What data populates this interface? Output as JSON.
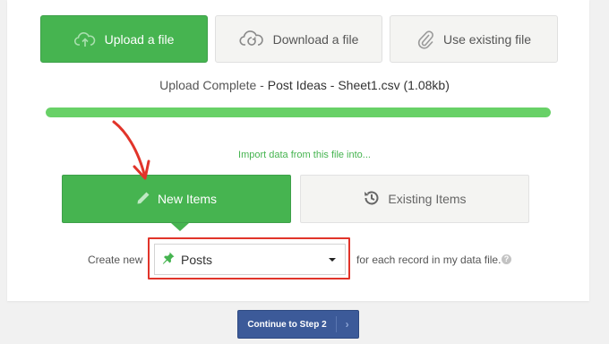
{
  "source_buttons": {
    "upload_label": "Upload a file",
    "download_label": "Download a file",
    "existing_label": "Use existing file"
  },
  "upload_status": {
    "prefix": "Upload Complete",
    "separator": " - ",
    "filename": "Post Ideas - Sheet1.csv (1.08kb)"
  },
  "progress": {
    "fraction": 1.0
  },
  "import_prompt": "Import data from this file into...",
  "target_buttons": {
    "new_label": "New Items",
    "existing_label": "Existing Items"
  },
  "create_row": {
    "prefix": "Create new",
    "selected_type": "Posts",
    "suffix": "for each record in my data file.",
    "help_glyph": "?"
  },
  "continue_button": {
    "label": "Continue to Step 2",
    "chevron": "›"
  },
  "colors": {
    "accent_green": "#46b450",
    "progress_green": "#68d167",
    "annotation_red": "#e1342a",
    "continue_blue": "#3c5a99"
  },
  "icons": {
    "upload": "cloud-upload-icon",
    "download": "cloud-download-icon",
    "existing": "paperclip-icon",
    "new_items": "pencil-icon",
    "existing_items": "history-icon",
    "posts": "pushpin-icon",
    "help": "help-icon"
  }
}
